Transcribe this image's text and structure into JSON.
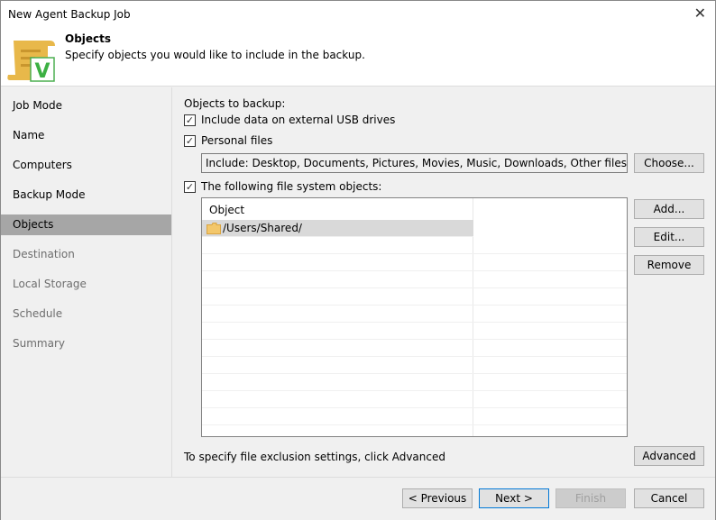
{
  "window": {
    "title": "New Agent Backup Job"
  },
  "header": {
    "title": "Objects",
    "subtitle": "Specify objects you would like to include in the backup."
  },
  "sidebar": {
    "items": [
      {
        "label": "Job Mode",
        "state": "normal"
      },
      {
        "label": "Name",
        "state": "normal"
      },
      {
        "label": "Computers",
        "state": "normal"
      },
      {
        "label": "Backup Mode",
        "state": "normal"
      },
      {
        "label": "Objects",
        "state": "selected"
      },
      {
        "label": "Destination",
        "state": "disabled"
      },
      {
        "label": "Local Storage",
        "state": "disabled"
      },
      {
        "label": "Schedule",
        "state": "disabled"
      },
      {
        "label": "Summary",
        "state": "disabled"
      }
    ]
  },
  "main": {
    "objects_label": "Objects to backup:",
    "usb_label": "Include data on external USB drives",
    "usb_checked": true,
    "personal_label": "Personal files",
    "personal_checked": true,
    "personal_include": "Include: Desktop, Documents, Pictures, Movies, Music, Downloads, Other files and folders",
    "choose_label": "Choose...",
    "fs_label": "The following file system objects:",
    "fs_checked": true,
    "table": {
      "header": "Object",
      "rows": [
        {
          "path": "/Users/Shared/",
          "icon": "folder-icon"
        }
      ]
    },
    "add_label": "Add...",
    "edit_label": "Edit...",
    "remove_label": "Remove",
    "exclusion_text": "To specify file exclusion settings, click Advanced",
    "advanced_label": "Advanced"
  },
  "footer": {
    "previous": "< Previous",
    "next": "Next >",
    "finish": "Finish",
    "cancel": "Cancel"
  }
}
